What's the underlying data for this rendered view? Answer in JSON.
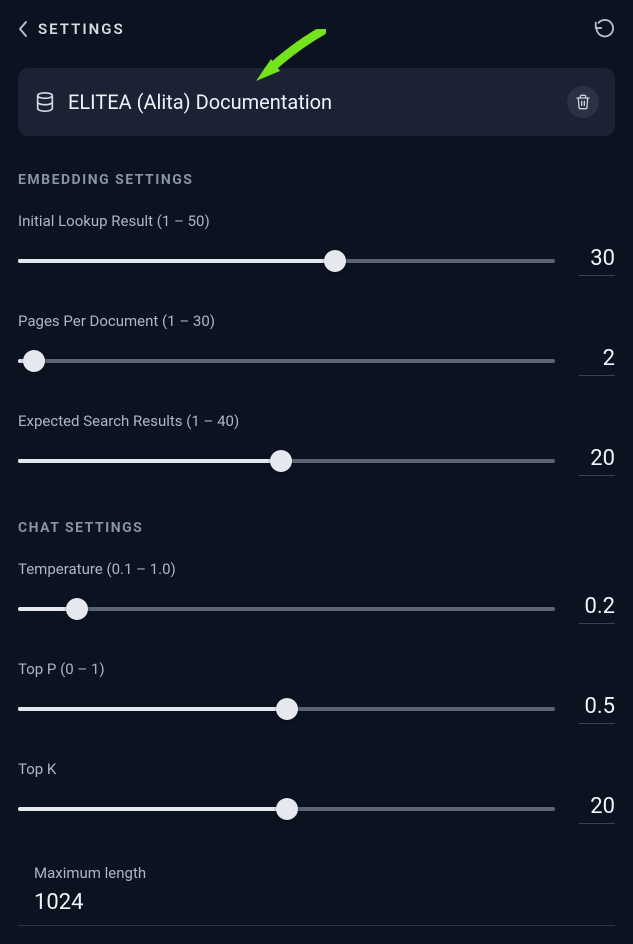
{
  "header": {
    "title": "SETTINGS"
  },
  "datasource": {
    "title": "ELITEA (Alita) Documentation"
  },
  "sections": {
    "embedding_title": "EMBEDDING SETTINGS",
    "chat_title": "CHAT SETTINGS"
  },
  "sliders": {
    "initial_lookup": {
      "label": "Initial Lookup Result (1 – 50)",
      "value": "30",
      "fill_pct": 59
    },
    "pages_per_doc": {
      "label": "Pages Per Document (1 – 30)",
      "value": "2",
      "fill_pct": 3
    },
    "expected_results": {
      "label": "Expected Search Results (1 – 40)",
      "value": "20",
      "fill_pct": 49
    },
    "temperature": {
      "label": "Temperature (0.1 – 1.0)",
      "value": "0.2",
      "fill_pct": 11
    },
    "top_p": {
      "label": "Top P (0 – 1)",
      "value": "0.5",
      "fill_pct": 50
    },
    "top_k": {
      "label": "Top K",
      "value": "20",
      "fill_pct": 50
    }
  },
  "maxlen": {
    "label": "Maximum length",
    "value": "1024"
  }
}
